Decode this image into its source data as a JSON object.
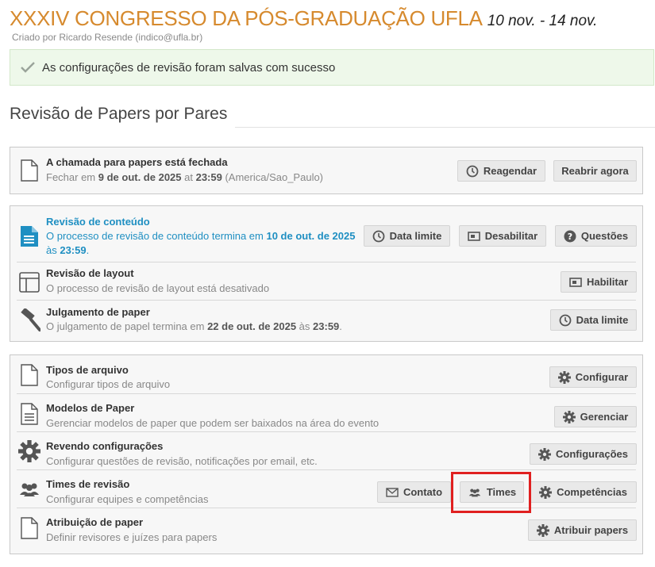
{
  "header": {
    "title": "XXXIV CONGRESSO DA PÓS-GRADUAÇÃO UFLA",
    "dates": "10 nov. - 14 nov.",
    "creator": "Criado por Ricardo Resende (indico@ufla.br)"
  },
  "alert": {
    "message": "As configurações de revisão foram salvas com sucesso"
  },
  "section": {
    "title": "Revisão de Papers por Pares"
  },
  "call": {
    "title": "A chamada para papers está fechada",
    "sub_prefix": "Fechar em ",
    "sub_date": "9 de out. de 2025",
    "sub_at": " at ",
    "sub_time": "23:59",
    "sub_tz": " (America/Sao_Paulo)",
    "reschedule": "Reagendar",
    "reopen": "Reabrir agora"
  },
  "content_review": {
    "title": "Revisão de conteúdo",
    "sub_prefix": "O processo de revisão de conteúdo termina em ",
    "sub_date": "10 de out. de 2025",
    "sub_at": "às ",
    "sub_time": "23:59",
    "sub_end": ".",
    "deadline": "Data limite",
    "disable": "Desabilitar",
    "questions": "Questões"
  },
  "layout_review": {
    "title": "Revisão de layout",
    "sub": "O processo de revisão de layout está desativado",
    "enable": "Habilitar"
  },
  "judging": {
    "title": "Julgamento de paper",
    "sub_prefix": "O julgamento de papel termina em ",
    "sub_date": "22 de out. de 2025",
    "sub_at": " às ",
    "sub_time": "23:59",
    "sub_end": ".",
    "deadline": "Data limite"
  },
  "file_types": {
    "title": "Tipos de arquivo",
    "sub": "Configurar tipos de arquivo",
    "button": "Configurar"
  },
  "templates": {
    "title": "Modelos de Paper",
    "sub": "Gerenciar modelos de paper que podem ser baixados na área do evento",
    "button": "Gerenciar"
  },
  "review_settings": {
    "title": "Revendo configurações",
    "sub": "Configurar questões de revisão, notificações por email, etc.",
    "button": "Configurações"
  },
  "review_teams": {
    "title": "Times de revisão",
    "sub": "Configurar equipes e competências",
    "contact": "Contato",
    "teams": "Times",
    "competences": "Competências"
  },
  "assignment": {
    "title": "Atribuição de paper",
    "sub": "Definir revisores e juízes para papers",
    "button": "Atribuir papers"
  },
  "colors": {
    "accent_title": "#d68a2e",
    "link_blue": "#1f8fc2",
    "success_bg": "#eef8ea",
    "highlight": "#e02020"
  }
}
